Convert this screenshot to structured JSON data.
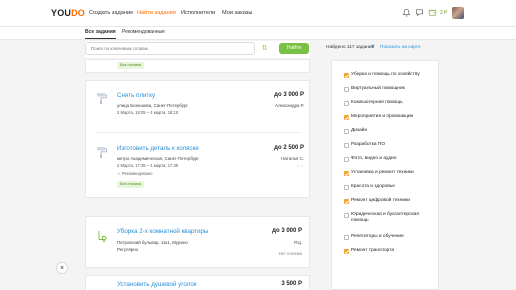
{
  "header": {
    "logo_left": "YOU",
    "logo_right": "DO",
    "nav": [
      "Создать задание",
      "Найти задания",
      "Исполнители",
      "Мои заказы"
    ],
    "balance": "2 Р"
  },
  "tabs": [
    "Все задания",
    "Рекомендованные"
  ],
  "search": {
    "placeholder": "Поиск по ключевым словам",
    "button": "Найти",
    "found": "Найдено 117 заданий",
    "map": "Показать на карте"
  },
  "tasks": [
    {
      "badge": "Без отклика"
    },
    {
      "title": "Снять плитку",
      "price": "до 3 000 Р",
      "address": "улица Бонншева, Санкт-Петербург",
      "user": "Александра Р.",
      "date": "2 Марта, 18:05 – 4 марта, 18:10"
    },
    {
      "title": "Изготовить деталь к коляске",
      "price": "до 2 500 Р",
      "address": "метро Академическая, Санкт-Петербург",
      "user": "Наталья С.",
      "date": "2 Марта, 17:35 – 4 марта, 17:35",
      "rec": "Рекомендовано",
      "badge": "Без отклика"
    },
    {
      "title": "Уборка 2-х комнатной квартиры",
      "price": "до 3 000 Р",
      "address": "Петровский бульвар, 11к1, Мурино",
      "address2": "Регулярно",
      "user": "Р.Ц.",
      "no_resp": "Нет отклика"
    },
    {
      "title": "Установить душевой уголок",
      "price": "3 500 Р"
    }
  ],
  "categories": [
    {
      "label": "Уборка и помощь по хозяйству",
      "checked": true
    },
    {
      "label": "Виртуальный помощник",
      "checked": false
    },
    {
      "label": "Компьютерная помощь",
      "checked": false
    },
    {
      "label": "Мероприятия и промоакции",
      "checked": true
    },
    {
      "label": "Дизайн",
      "checked": false
    },
    {
      "label": "Разработка ПО",
      "checked": false
    },
    {
      "label": "Фото, видео и аудио",
      "checked": false
    },
    {
      "label": "Установка и ремонт техники",
      "checked": true
    },
    {
      "label": "Красота и здоровье",
      "checked": false
    },
    {
      "label": "Ремонт цифровой техники",
      "checked": true
    },
    {
      "label": "Юридическая и бухгалтерская помощь",
      "checked": false
    },
    {
      "label": "Репетиторы и обучение",
      "checked": false
    },
    {
      "label": "Ремонт транспорта",
      "checked": true
    }
  ],
  "colors": {
    "accent": "#ff6d00",
    "green": "#7ac143",
    "link": "#2b8fd6",
    "checkbox": "#f2a233"
  },
  "close_icon": "×"
}
